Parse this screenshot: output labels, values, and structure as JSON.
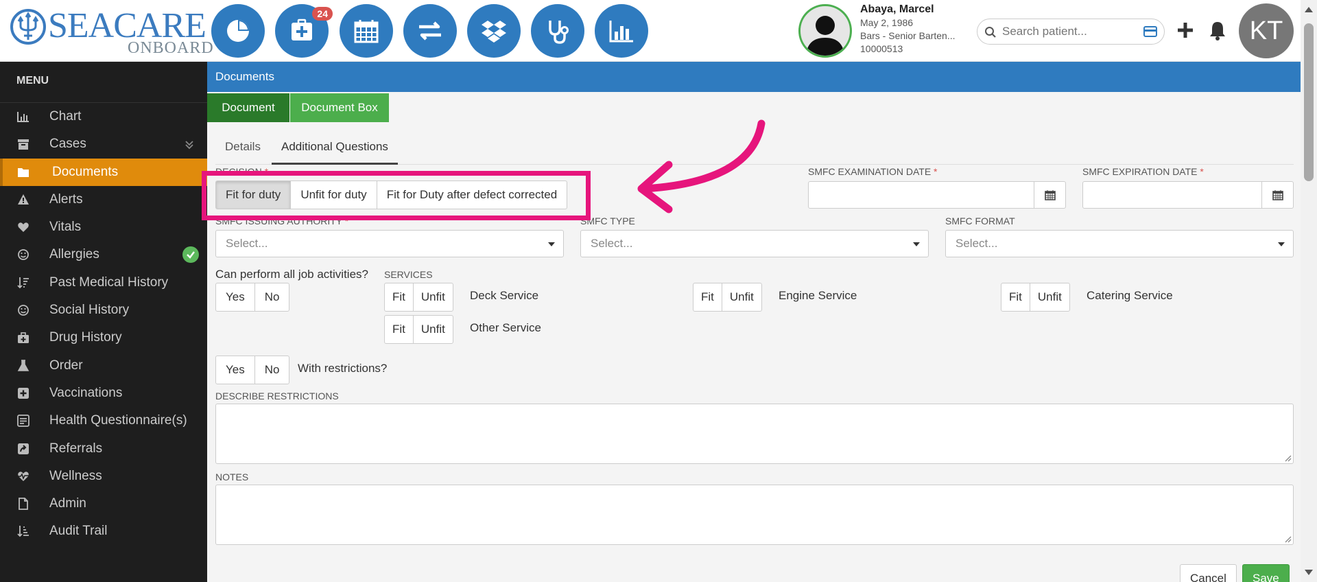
{
  "brand": {
    "name": "SEACARE",
    "sub": "ONBOARD"
  },
  "nav": {
    "icons": [
      "pie-chart-icon",
      "medical-plus-icon",
      "calendar-icon",
      "transfer-arrows-icon",
      "dropbox-icon",
      "stethoscope-icon",
      "bar-chart-icon"
    ],
    "badge_count": "24"
  },
  "patient": {
    "name": "Abaya, Marcel",
    "dob": "May 2, 1986",
    "role": "Bars - Senior Barten...",
    "id": "10000513"
  },
  "search": {
    "placeholder": "Search patient..."
  },
  "user": {
    "initials": "KT"
  },
  "menu": {
    "title": "MENU",
    "items": [
      {
        "label": "Chart",
        "icon": "bar-chart-icon"
      },
      {
        "label": "Cases",
        "icon": "archive-icon"
      },
      {
        "label": "Documents",
        "icon": "folder-icon"
      },
      {
        "label": "Alerts",
        "icon": "warning-icon"
      },
      {
        "label": "Vitals",
        "icon": "heart-icon"
      },
      {
        "label": "Allergies",
        "icon": "smiley-icon"
      },
      {
        "label": "Past Medical History",
        "icon": "sort-icon"
      },
      {
        "label": "Social History",
        "icon": "smiley-icon"
      },
      {
        "label": "Drug History",
        "icon": "medkit-icon"
      },
      {
        "label": "Order",
        "icon": "flask-icon"
      },
      {
        "label": "Vaccinations",
        "icon": "plus-square-icon"
      },
      {
        "label": "Health Questionnaire(s)",
        "icon": "form-icon"
      },
      {
        "label": "Referrals",
        "icon": "share-square-icon"
      },
      {
        "label": "Wellness",
        "icon": "heartbeat-icon"
      },
      {
        "label": "Admin",
        "icon": "file-icon"
      },
      {
        "label": "Audit Trail",
        "icon": "sort-amount-icon"
      }
    ]
  },
  "header": {
    "title": "Documents"
  },
  "buttons": {
    "document": "Document",
    "document_box": "Document Box"
  },
  "tabs": [
    "Details",
    "Additional Questions"
  ],
  "form": {
    "decision_label": "DECISION",
    "decision_options": [
      "Fit for duty",
      "Unfit for duty",
      "Fit for Duty after defect corrected"
    ],
    "decision_selected": "Fit for duty",
    "exam_date_label": "SMFC EXAMINATION DATE",
    "expiration_date_label": "SMFC EXPIRATION DATE",
    "issuing_authority_label": "SMFC ISSUING AUTHORITY",
    "type_label": "SMFC TYPE",
    "format_label": "SMFC FORMAT",
    "select_placeholder": "Select...",
    "job_activities_label": "Can perform all job activities?",
    "yes": "Yes",
    "no": "No",
    "services_label": "SERVICES",
    "fit": "Fit",
    "unfit": "Unfit",
    "services": [
      "Deck Service",
      "Engine Service",
      "Catering Service",
      "Other Service"
    ],
    "with_restrictions_label": "With restrictions?",
    "describe_restrictions_label": "DESCRIBE RESTRICTIONS",
    "notes_label": "NOTES"
  },
  "actions": {
    "cancel": "Cancel",
    "save": "Save"
  },
  "colors": {
    "primary": "#2f7bbf",
    "active_menu": "#e08b0c",
    "green": "#4cae4c",
    "highlight": "#e6157c",
    "sidebar": "#1e1e1e"
  }
}
